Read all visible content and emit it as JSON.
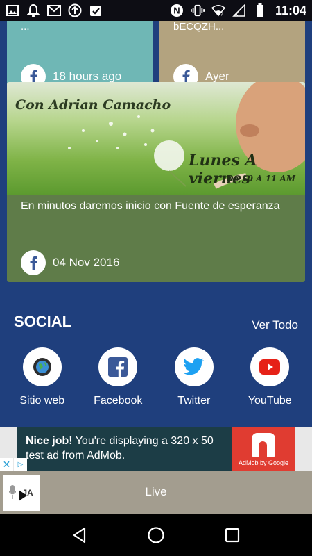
{
  "status_bar": {
    "time": "11:04",
    "left_icons": [
      "gallery-icon",
      "bell-icon",
      "gmail-icon",
      "upload-icon",
      "clipboard-check-icon"
    ],
    "right_icons": [
      "nfc-icon",
      "vibrate-icon",
      "wifi-icon",
      "signal-icon",
      "battery-icon"
    ]
  },
  "cards": {
    "top_left": {
      "title": "...",
      "date": "18 hours ago",
      "color": "#6fb7b5"
    },
    "top_right": {
      "title": "bECQZH...",
      "date": "Ayer",
      "color": "#b3a37f"
    },
    "main": {
      "image_text_1": "Con Adrian Camacho",
      "image_text_2": "Lunes A viernes",
      "image_text_3": "De 10 A 11 AM",
      "title": "En minutos daremos inicio con Fuente de esperanza",
      "date": "04 Nov 2016",
      "color": "#5f7c49"
    }
  },
  "social": {
    "title": "SOCIAL",
    "view_all": "Ver Todo",
    "items": [
      {
        "label": "Sitio web",
        "icon": "globe-icon"
      },
      {
        "label": "Facebook",
        "icon": "facebook-icon"
      },
      {
        "label": "Twitter",
        "icon": "twitter-icon"
      },
      {
        "label": "YouTube",
        "icon": "youtube-icon"
      }
    ]
  },
  "ad": {
    "headline": "Nice job!",
    "body": " You're displaying a 320 x 50 test ad from AdMob.",
    "logo_text": "AdMob by Google",
    "close_glyph": "✕",
    "choices_glyph": "▷"
  },
  "player": {
    "thumb_text": "JA",
    "label": "Live"
  },
  "colors": {
    "background": "#1f3f7d",
    "facebook_blue": "#3b5998",
    "twitter_blue": "#1da1f2",
    "youtube_red": "#e62117",
    "admob_red": "#e03c31"
  }
}
